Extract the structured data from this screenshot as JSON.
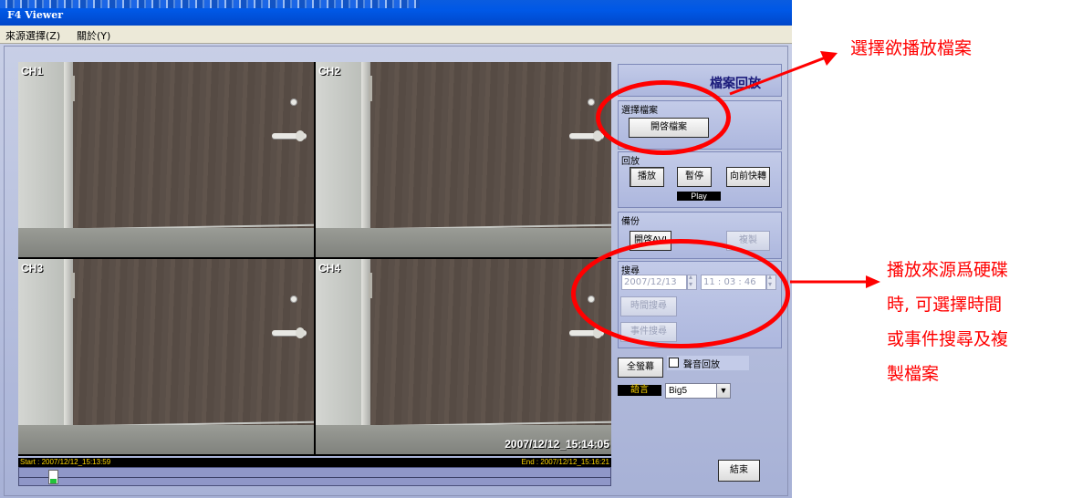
{
  "window": {
    "title": "F4 Viewer"
  },
  "menubar": {
    "items": [
      {
        "label": "來源選擇(Z)"
      },
      {
        "label": "關於(Y)"
      }
    ]
  },
  "video": {
    "cameras": [
      {
        "label": "CH1"
      },
      {
        "label": "CH2"
      },
      {
        "label": "CH3"
      },
      {
        "label": "CH4"
      }
    ],
    "timestamp": "2007/12/12_15:14:05",
    "start_label": "Start : 2007/12/12_15:13:59",
    "end_label": "End : 2007/12/12_15:16:21",
    "position_fraction": 0.05
  },
  "panel": {
    "header_title": "檔案回放",
    "select_file": {
      "legend": "選擇檔案",
      "open_button": "開啓檔案"
    },
    "playback": {
      "legend": "回放",
      "play_button": "播放",
      "pause_button": "暫停",
      "forward_button": "向前快轉",
      "status": "Play"
    },
    "backup": {
      "legend": "備份",
      "open_avi_button": "開啓AVI",
      "copy_button": "複製"
    },
    "search": {
      "legend": "搜尋",
      "date_value": "2007/12/13",
      "time_value": "11 : 03 : 46",
      "time_search_button": "時間搜尋",
      "event_search_button": "事件搜尋"
    },
    "fullscreen_button": "全螢幕",
    "audio_checkbox_label": "聲音回放",
    "audio_checked": false,
    "language_label": "語言",
    "language_value": "Big5",
    "exit_button": "結束"
  },
  "annotations": {
    "top_text": "選擇欲播放檔案",
    "side_lines": [
      "播放來源爲硬碟",
      "時, 可選擇時間",
      "或事件搜尋及複",
      "製檔案"
    ],
    "color": "#ff0000"
  }
}
